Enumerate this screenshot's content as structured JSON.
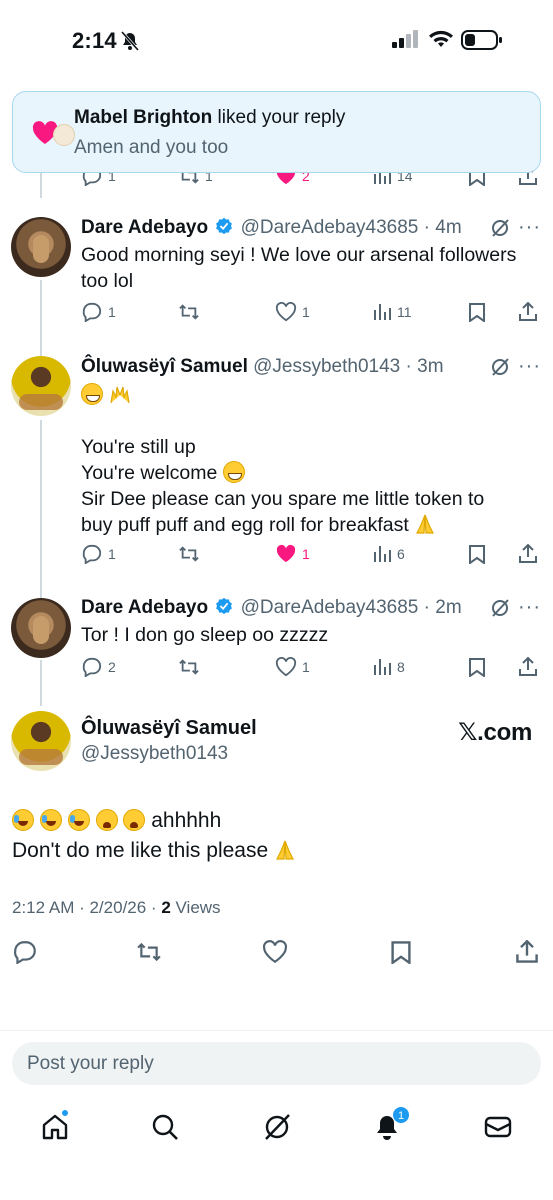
{
  "status_bar": {
    "time": "2:14"
  },
  "notification": {
    "actor": "Mabel Brighton",
    "action": " liked your reply",
    "text": "Amen and you too"
  },
  "partial_actions": {
    "replies": "1",
    "reposts": "1",
    "likes": "2",
    "views": "14"
  },
  "tweets": [
    {
      "name": "Dare Adebayo",
      "handle": "@DareAdebay43685",
      "time": "4m",
      "lines": [
        "Good morning seyi ! We love our arsenal followers",
        "too lol"
      ],
      "replies": "1",
      "reposts": "",
      "likes": "1",
      "views": "11",
      "liked": false
    },
    {
      "name": "Ôluwasëyî Samuel",
      "handle": "@Jessybeth0143",
      "time": "3m",
      "lines": [
        "You're still up",
        "You're welcome",
        "Sir Dee please can you spare me little token to",
        "buy puff puff and egg roll for breakfast"
      ],
      "replies": "1",
      "reposts": "",
      "likes": "1",
      "views": "6",
      "liked": true
    },
    {
      "name": "Dare Adebayo",
      "handle": "@DareAdebay43685",
      "time": "2m",
      "lines": [
        "Tor ! I don go sleep oo zzzzz"
      ],
      "replies": "2",
      "reposts": "",
      "likes": "1",
      "views": "8",
      "liked": false
    }
  ],
  "main_tweet": {
    "name": "Ôluwasëyî Samuel",
    "handle": "@Jessybeth0143",
    "brand": "𝕏.com",
    "line1_text": "ahhhhh",
    "line2_text": "Don't do me like this please",
    "timestamp": "2:12 AM · 2/20/26 · ",
    "views_count": "2",
    "views_label": " Views"
  },
  "reply_box": {
    "placeholder": "Post your reply"
  },
  "tabbar": {
    "notifications_badge": "1"
  },
  "colors": {
    "accent": "#1d9bf0",
    "like": "#f91880",
    "text": "#0f1419",
    "muted": "#536471"
  },
  "icons": [
    "bell-off-icon",
    "signal-icon",
    "wifi-icon",
    "battery-icon",
    "heart-icon",
    "verified-icon",
    "grok-icon",
    "reply-icon",
    "repost-icon",
    "like-icon",
    "views-icon",
    "bookmark-icon",
    "share-icon",
    "home-icon",
    "search-icon",
    "grok-tab-icon",
    "notifications-icon",
    "messages-icon"
  ]
}
